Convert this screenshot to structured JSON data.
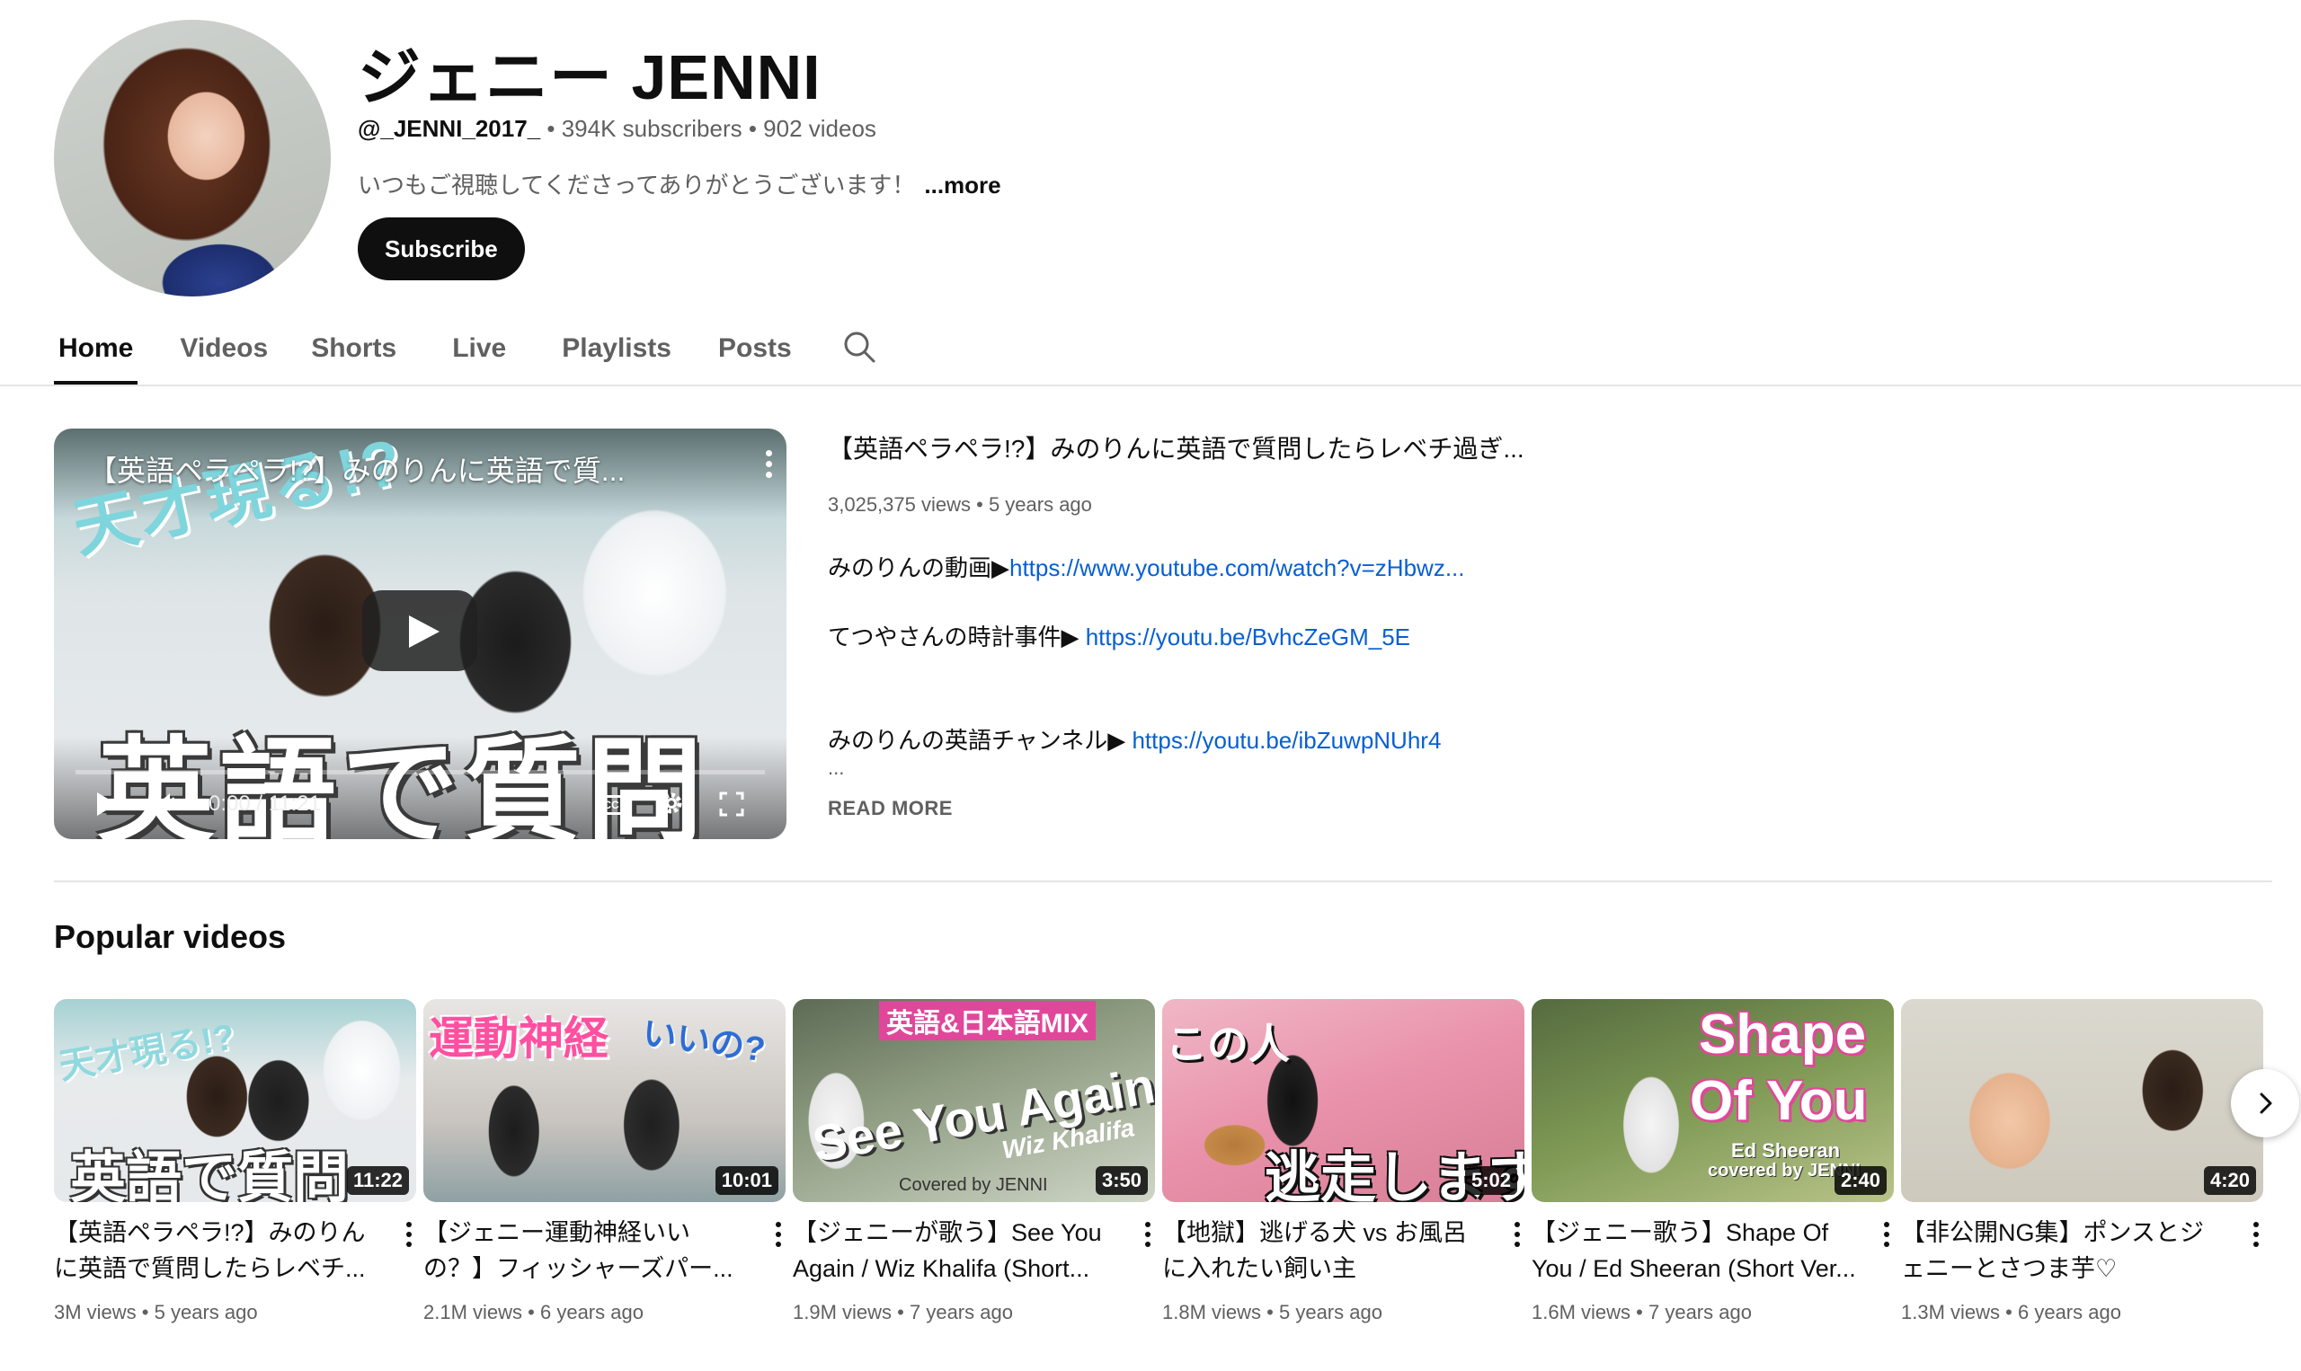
{
  "channel": {
    "name": "ジェニー JENNI",
    "handle": "@_JENNI_2017_",
    "subscribers": "394K subscribers",
    "videos_count": "902 videos",
    "separator": " • ",
    "description": "いつもご視聴してくださってありがとうございます！",
    "more_label": "...more",
    "subscribe_label": "Subscribe"
  },
  "tabs": [
    {
      "label": "Home",
      "active": true
    },
    {
      "label": "Videos"
    },
    {
      "label": "Shorts"
    },
    {
      "label": "Live"
    },
    {
      "label": "Playlists"
    },
    {
      "label": "Posts"
    }
  ],
  "featured": {
    "player_title": "【英語ペラペラ!?】みのりんに英語で質...",
    "thumb_top_text": "天才現る!?",
    "thumb_bottom_text": "英語で質問",
    "time": "0:00 / 11:21",
    "cc_label": "CC",
    "title": "【英語ペラペラ!?】みのりんに英語で質問したらレベチ過ぎ...",
    "views": "3,025,375 views",
    "age": "5 years ago",
    "desc": [
      {
        "text": "みのりんの動画▶",
        "link": "https://www.youtube.com/watch?v=zHbwz..."
      },
      {
        "text": "てつやさんの時計事件▶ ",
        "link": "https://youtu.be/BvhcZeGM_5E"
      },
      {
        "text": "みのりんの英語チャンネル▶ ",
        "link": "https://youtu.be/ibZuwpNUhr4"
      }
    ],
    "ellipsis": "...",
    "read_more": "READ MORE"
  },
  "popular": {
    "title": "Popular videos",
    "videos": [
      {
        "thumb_text": "天才現る!?",
        "thumb_text2": "英語で質問",
        "duration": "11:22",
        "title1": "【英語ペラペラ!?】みのりん",
        "title2": "に英語で質問したらレベチ...",
        "views": "3M views",
        "age": "5 years ago"
      },
      {
        "thumb_text": "運動神経",
        "thumb_text2": "いいの?",
        "duration": "10:01",
        "title1": "【ジェニー運動神経いい",
        "title2": "の？】フィッシャーズパー...",
        "views": "2.1M views",
        "age": "6 years ago"
      },
      {
        "thumb_text": "英語&日本語MIX",
        "thumb_text2": "See You Again",
        "thumb_text3": "Wiz Khalifa",
        "thumb_text4": "Covered by JENNI",
        "duration": "3:50",
        "title1": "【ジェニーが歌う】See You",
        "title2": "Again / Wiz Khalifa (Short...",
        "views": "1.9M views",
        "age": "7 years ago"
      },
      {
        "thumb_text": "この人",
        "thumb_text2": "逃走します",
        "duration": "5:02",
        "title1": "【地獄】逃げる犬 vs お風呂",
        "title2": "に入れたい飼い主",
        "views": "1.8M views",
        "age": "5 years ago"
      },
      {
        "thumb_text": "Shape",
        "thumb_text2": "Of You",
        "thumb_text3": "Ed Sheeran",
        "thumb_text4": "covered by JENNI",
        "duration": "2:40",
        "title1": "【ジェニー歌う】Shape Of",
        "title2": "You / Ed Sheeran (Short Ver...",
        "views": "1.6M views",
        "age": "7 years ago"
      },
      {
        "thumb_text": "",
        "duration": "4:20",
        "title1": "【非公開NG集】ポンスとジ",
        "title2": "ェニーとさつま芋♡",
        "views": "1.3M views",
        "age": "6 years ago"
      }
    ]
  }
}
